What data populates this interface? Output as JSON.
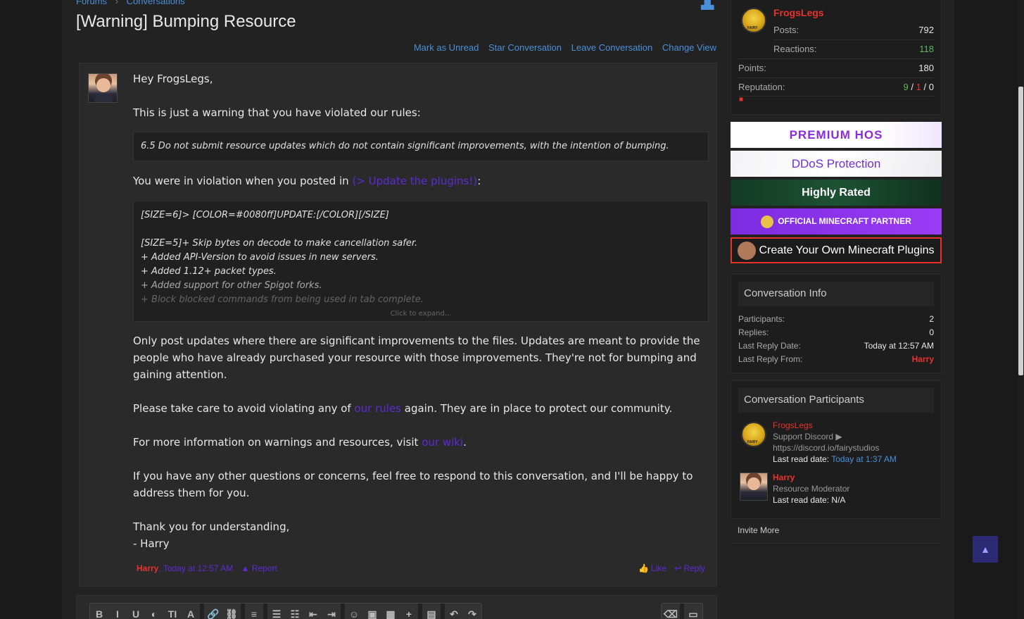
{
  "breadcrumb": {
    "forums": "Forums",
    "sep": "›",
    "conversations": "Conversations"
  },
  "title": "[Warning] Bumping Resource",
  "nav_icon": "sitemap-icon",
  "actions": {
    "mark_unread": "Mark as Unread",
    "star": "Star Conversation",
    "leave": "Leave Conversation",
    "change_view": "Change View"
  },
  "message": {
    "greeting": "Hey FrogsLegs,",
    "intro": "This is just a warning that you have violated our rules:",
    "rule_quote": "6.5 Do not submit resource updates which do not contain significant improvements, with the intention of bumping.",
    "violation_prefix": "You were in violation when you posted in",
    "violation_link": "(> Update the plugins!)",
    "violation_suffix": ":",
    "code_lines": [
      "[SIZE=6]> [COLOR=#0080ff]UPDATE:[/COLOR][/SIZE]",
      "",
      "[SIZE=5]+ Skip bytes on decode to make cancellation safer.",
      "+ Added API-Version to avoid issues in new servers.",
      "+ Added 1.12+ packet types.",
      "+ Added support for other Spigot forks.",
      "+ Block blocked commands from being used in tab complete."
    ],
    "code_more": "Click to expand...",
    "para_updates": "Only post updates where there are significant improvements to the files. Updates are meant to provide the people who have already purchased your resource with those improvements. They're not for bumping and gaining attention.",
    "para_rules_prefix": "Please take care to avoid violating any of",
    "para_rules_link": "our rules",
    "para_rules_suffix": "again. They are in place to protect our community.",
    "para_wiki_prefix": "For more information on warnings and resources, visit",
    "para_wiki_link": "our wiki",
    "para_wiki_suffix": ".",
    "para_questions": "If you have any other questions or concerns, feel free to respond to this conversation, and I'll be happy to address them for you.",
    "signoff": "Thank you for understanding,",
    "signature": "- Harry",
    "footer": {
      "author": "Harry",
      "comma": ",",
      "date": "Today at 12:57 AM",
      "report": "Report",
      "like": "Like",
      "reply": "Reply"
    }
  },
  "toolbar": {
    "buttons": [
      "B",
      "I",
      "U",
      "◐",
      "TI",
      "A",
      "🔗",
      "⛓",
      "≡",
      "☰",
      "☷",
      "⇤",
      "⇥",
      "☺",
      "▣",
      "▦",
      "+",
      "▤",
      "↶",
      "↷",
      "⌫",
      "▭"
    ]
  },
  "user_panel": {
    "name": "FrogsLegs",
    "posts_label": "Posts:",
    "posts": "792",
    "reactions_label": "Reactions:",
    "reactions": "118",
    "points_label": "Points:",
    "points": "180",
    "reputation_label": "Reputation:",
    "rep_pos": "9",
    "rep_neg": "1",
    "rep_neu": "0",
    "rep_sep": "/"
  },
  "banners": {
    "b1": "PREMIUM HOS",
    "b2": "DDoS Protection",
    "b3": "Highly Rated",
    "b4": "OFFICIAL MINECRAFT PARTNER",
    "b5": "Create Your Own Minecraft Plugins"
  },
  "conversation_info": {
    "heading": "Conversation Info",
    "participants_label": "Participants:",
    "participants": "2",
    "replies_label": "Replies:",
    "replies": "0",
    "last_reply_date_label": "Last Reply Date:",
    "last_reply_date": "Today at 12:57 AM",
    "last_reply_from_label": "Last Reply From:",
    "last_reply_from": "Harry"
  },
  "participants": {
    "heading": "Conversation Participants",
    "p1": {
      "name": "FrogsLegs",
      "line1": "Support Discord ▶",
      "line2": "https://discord.io/fairystudios",
      "read_label": "Last read date:",
      "read_value": "Today at 1:37 AM"
    },
    "p2": {
      "name": "Harry",
      "line1": "Resource Moderator",
      "read_label": "Last read date:",
      "read_value": "N/A"
    },
    "invite": "Invite More"
  },
  "scroll_top_icon": "▲",
  "colors": {
    "accent": "#4a90d9",
    "author_red": "#e8332c",
    "link_purple": "#5b2bd6",
    "positive_green": "#5cb85c"
  }
}
